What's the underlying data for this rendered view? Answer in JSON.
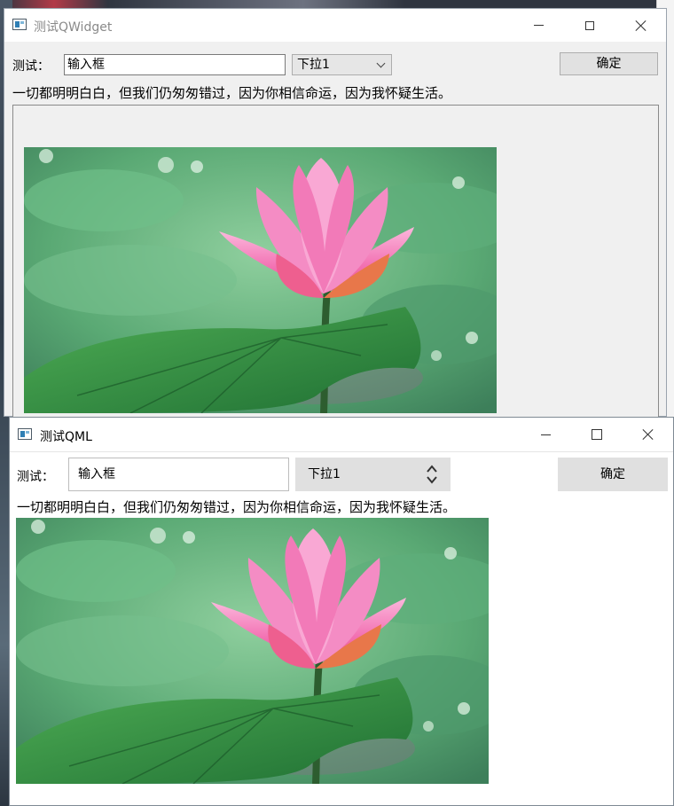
{
  "widget_window": {
    "title": "测试QWidget",
    "label": "测试：",
    "input_value": "输入框",
    "combo_selected": "下拉1",
    "confirm_label": "确定",
    "text": "一切都明明白白，但我们仍匆匆错过，因为你相信命运，因为我怀疑生活。"
  },
  "qml_window": {
    "title": "测试QML",
    "label": "测试：",
    "input_value": "输入框",
    "combo_selected": "下拉1",
    "confirm_label": "确定",
    "text": "一切都明明白白，但我们仍匆匆错过，因为你相信命运，因为我怀疑生活。"
  },
  "icons": {
    "app": "app-window-icon",
    "minimize": "minimize-icon",
    "maximize": "maximize-icon",
    "close": "close-icon",
    "dropdown": "chevron-down-icon",
    "spinner": "up-down-chevron-icon"
  },
  "colors": {
    "window_bg": "#f0f0f0",
    "titlebar_bg": "#ffffff",
    "qml_control_bg": "#e0e0e0",
    "lotus_pink": "#f06fb0",
    "leaf_green": "#2f8f45"
  }
}
